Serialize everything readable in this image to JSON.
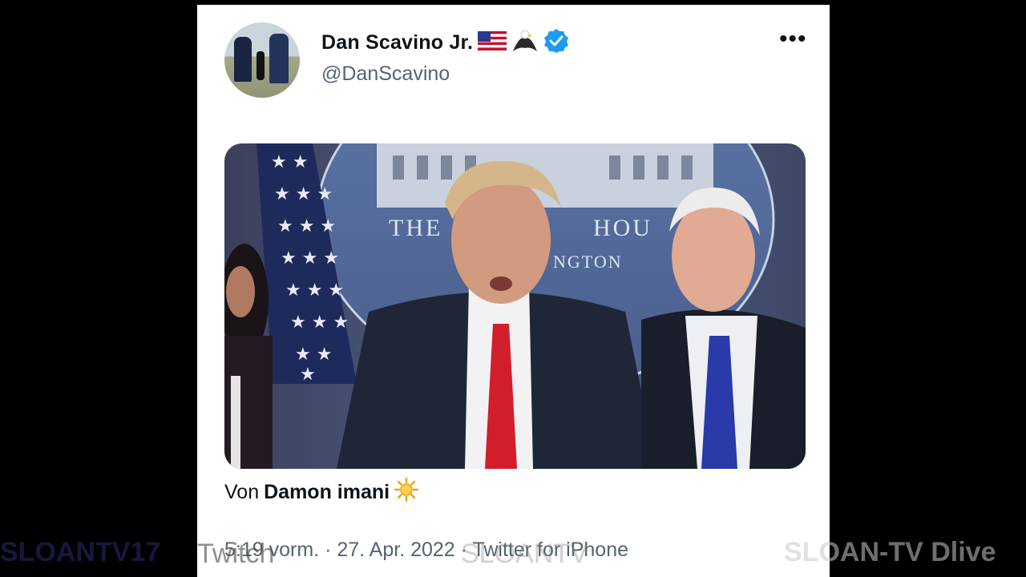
{
  "tweet": {
    "author_name": "Dan Scavino Jr.",
    "handle": "@DanScavino",
    "more_label": "•••",
    "caption_prefix": "Von",
    "caption_author": "Damon imani",
    "time": "5:19 vorm.",
    "separator": "·",
    "date": "27. Apr. 2022",
    "source": "Twitter for iPhone"
  },
  "media_text": {
    "seal_left": "THE",
    "seal_right": "HOU",
    "seal_bottom": "NGTON"
  },
  "watermarks": {
    "left": "SLOANTV17",
    "twitch": "Twitch",
    "center": "SLOANTV",
    "right": "SLOAN-TV Dlive"
  },
  "icons": {
    "flag": "us-flag-icon",
    "eagle": "eagle-icon",
    "verified": "verified-badge-icon",
    "more": "more-icon",
    "sun": "sun-icon"
  },
  "colors": {
    "verified": "#1d9bf0",
    "secondary_text": "#536471",
    "primary_text": "#0f1419",
    "background": "#000000"
  }
}
